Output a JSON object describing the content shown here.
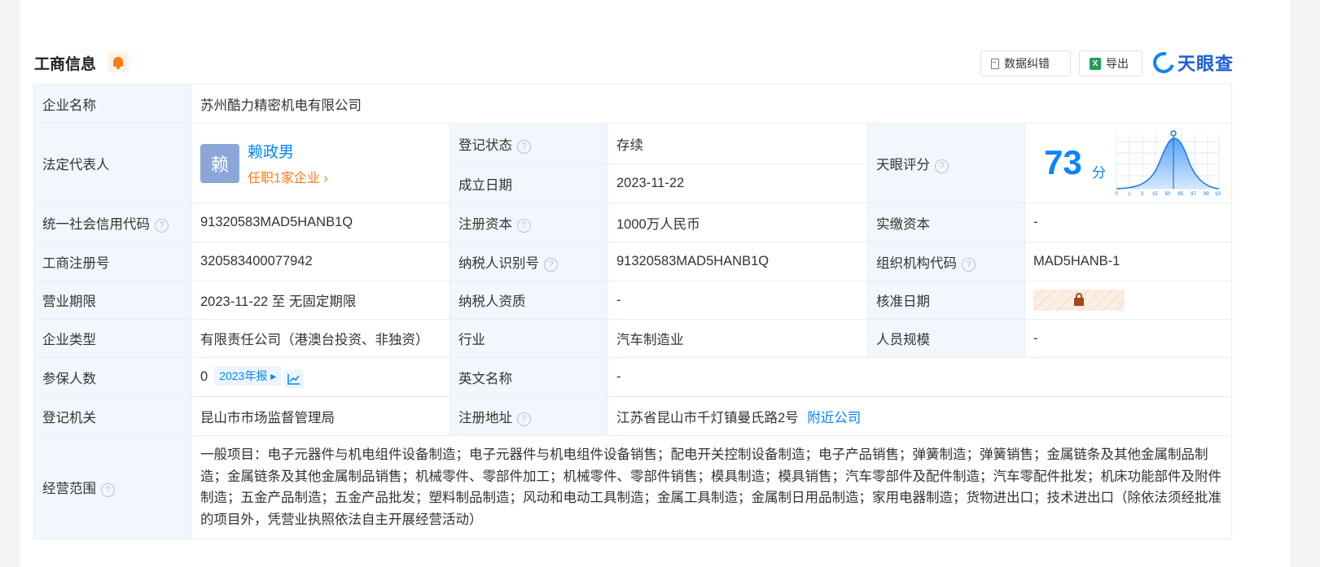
{
  "header": {
    "title": "工商信息",
    "correct_label": "数据纠错",
    "export_label": "导出",
    "logo_text": "天眼查",
    "excel_glyph": "X"
  },
  "colors": {
    "accent_blue": "#0084ff",
    "label_bg": "#f1f7fd",
    "status_green": "#1aa35a",
    "orange": "#ff7a1a"
  },
  "labels": {
    "company_name": "企业名称",
    "legal_rep": "法定代表人",
    "reg_status": "登记状态",
    "found_date": "成立日期",
    "tianyan_score": "天眼评分",
    "credit_code": "统一社会信用代码",
    "reg_capital": "注册资本",
    "paid_capital": "实缴资本",
    "reg_number": "工商注册号",
    "taxpayer_id": "纳税人识别号",
    "org_code": "组织机构代码",
    "business_term": "营业期限",
    "taxpayer_qual": "纳税人资质",
    "approval_date": "核准日期",
    "company_type": "企业类型",
    "industry": "行业",
    "staff_size": "人员规模",
    "insured_count": "参保人数",
    "english_name": "英文名称",
    "reg_authority": "登记机关",
    "reg_address": "注册地址",
    "business_scope": "经营范围"
  },
  "values": {
    "company_name": "苏州酷力精密机电有限公司",
    "avatar_char": "赖",
    "legal_rep_name": "赖政男",
    "legal_rep_jobs": "任职1家企业",
    "reg_status": "存续",
    "found_date": "2023-11-22",
    "score": "73",
    "score_unit": "分",
    "credit_code": "91320583MAD5HANB1Q",
    "reg_capital": "1000万人民币",
    "paid_capital": "-",
    "reg_number": "320583400077942",
    "taxpayer_id": "91320583MAD5HANB1Q",
    "org_code": "MAD5HANB-1",
    "business_term": "2023-11-22 至 无固定期限",
    "taxpayer_qual": "-",
    "company_type": "有限责任公司（港澳台投资、非独资）",
    "industry": "汽车制造业",
    "staff_size": "-",
    "insured_count": "0",
    "annual_report": "2023年报",
    "english_name": "-",
    "reg_authority": "昆山市市场监督管理局",
    "reg_address": "江苏省昆山市千灯镇曼氏路2号",
    "nearby": "附近公司",
    "business_scope": "一般项目：电子元器件与机电组件设备制造；电子元器件与机电组件设备销售；配电开关控制设备制造；电子产品销售；弹簧制造；弹簧销售；金属链条及其他金属制品制造；金属链条及其他金属制品销售；机械零件、零部件加工；机械零件、零部件销售；模具制造；模具销售；汽车零部件及配件制造；汽车零配件批发；机床功能部件及附件制造；五金产品制造；五金产品批发；塑料制品制造；风动和电动工具制造；金属工具制造；金属制日用品制造；家用电器制造；货物进出口；技术进出口（除依法须经批准的项目外，凭营业执照依法自主开展经营活动）"
  },
  "score_chart": {
    "x_ticks": [
      "0",
      "1",
      "3",
      "15",
      "50",
      "85",
      "97",
      "99",
      "100"
    ],
    "marker": "73"
  }
}
